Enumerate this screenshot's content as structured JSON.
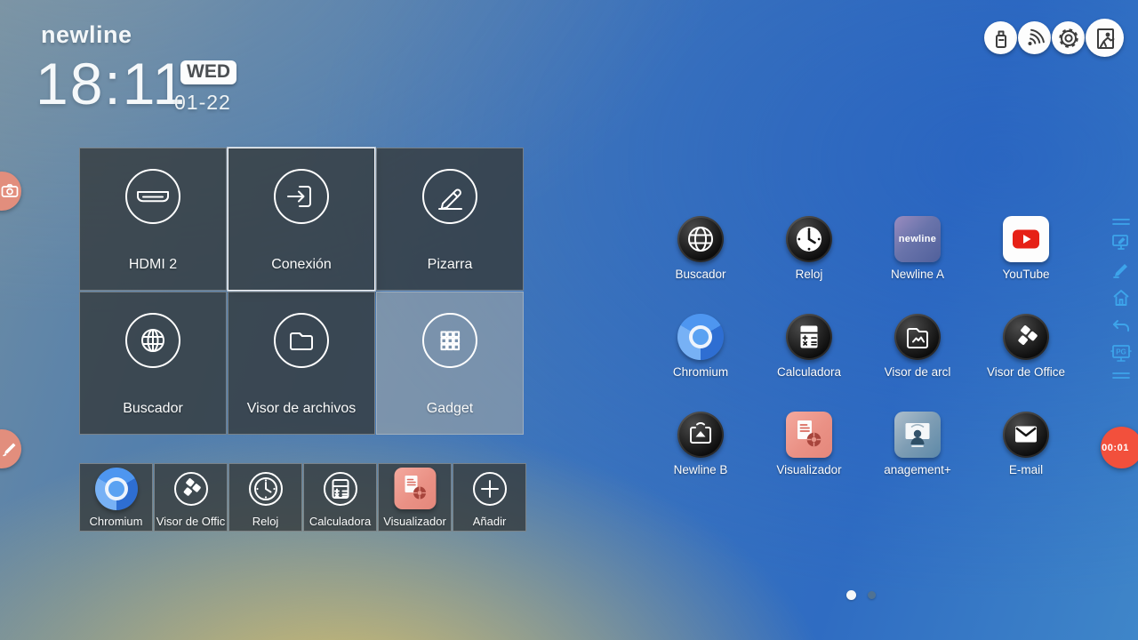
{
  "brand": {
    "logo": "newline"
  },
  "clock": {
    "time": "18:11",
    "weekday": "WED",
    "date": "01-22"
  },
  "status_bar": {
    "icons": [
      {
        "name": "usb-drive-icon"
      },
      {
        "name": "wireless-hotspot-icon"
      },
      {
        "name": "settings-gear-icon"
      },
      {
        "name": "exit-icon"
      }
    ]
  },
  "main_tiles": [
    {
      "label": "HDMI 2",
      "icon": "hdmi-icon"
    },
    {
      "label": "Conexión",
      "icon": "connect-icon",
      "selected": true
    },
    {
      "label": "Pizarra",
      "icon": "whiteboard-pencil-icon"
    },
    {
      "label": "Buscador",
      "icon": "globe-icon"
    },
    {
      "label": "Visor de archivos",
      "icon": "folder-icon"
    },
    {
      "label": "Gadget",
      "icon": "app-grid-icon"
    }
  ],
  "dock_tiles": [
    {
      "label": "Chromium",
      "icon": "chromium-icon"
    },
    {
      "label": "Visor de Offic",
      "icon": "office-icon"
    },
    {
      "label": "Reloj",
      "icon": "clock-icon"
    },
    {
      "label": "Calculadora",
      "icon": "calculator-icon"
    },
    {
      "label": "Visualizador",
      "icon": "visualizer-icon"
    },
    {
      "label": "Añadir",
      "icon": "plus-icon"
    }
  ],
  "app_grid": [
    {
      "label": "Buscador",
      "icon": "globe-icon"
    },
    {
      "label": "Reloj",
      "icon": "clock-icon"
    },
    {
      "label": "Newline A",
      "icon": "newline-app-icon",
      "icon_text": "newline"
    },
    {
      "label": "YouTube",
      "icon": "youtube-icon"
    },
    {
      "label": "Chromium",
      "icon": "chromium-icon"
    },
    {
      "label": "Calculadora",
      "icon": "calculator-icon"
    },
    {
      "label": "Visor de arcl",
      "icon": "image-folder-icon"
    },
    {
      "label": "Visor de Office",
      "icon": "office-icon"
    },
    {
      "label": "Newline B",
      "icon": "broadcast-icon"
    },
    {
      "label": "Visualizador",
      "icon": "visualizer-icon"
    },
    {
      "label": "anagement+",
      "icon": "display-management-icon"
    },
    {
      "label": "E-mail",
      "icon": "envelope-icon"
    }
  ],
  "side_toolbar": {
    "pg_label": "PG"
  },
  "floating": {
    "timer": "00:01"
  },
  "pager": {
    "total": 2,
    "active": 1
  },
  "colors": {
    "timer_red": "#f2503c",
    "salmon": "#e28e7d",
    "toolbar_blue": "#3da4ea",
    "tile_dark": "rgba(54,60,62,0.82)"
  }
}
